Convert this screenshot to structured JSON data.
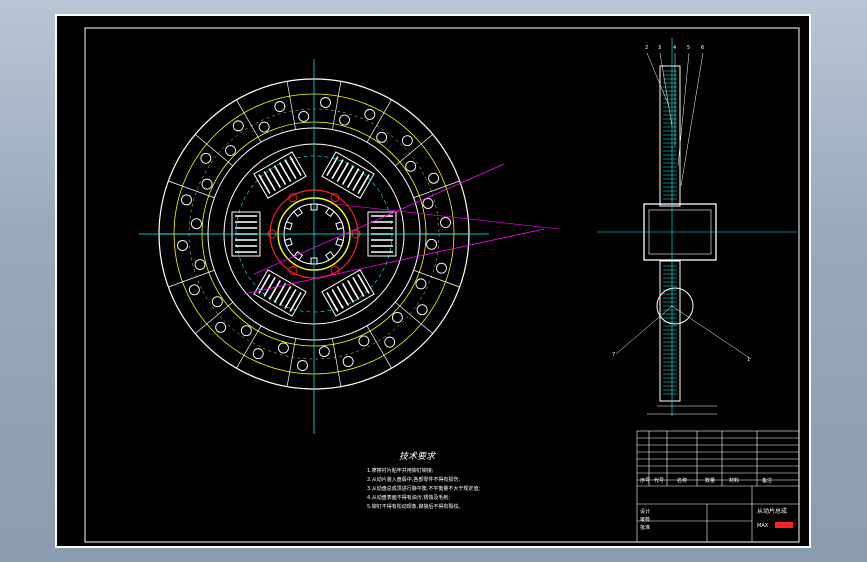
{
  "drawing": {
    "tech_title": "技术要求",
    "tech_notes": [
      "1.摩擦衬片粘牢并用铆钉铆接;",
      "2.从动片装入盘毂中,各部零件不得有损伤;",
      "3.从动盘总成须进行静平衡,不平衡量不大于规定值;",
      "4.从动盘表面不得有油污,锈蚀及毛刺;",
      "5.铆钉不得有松动现象,铆接后不得有裂纹。"
    ],
    "section_callouts": [
      "2",
      "3",
      "4",
      "5",
      "6",
      "7",
      "1"
    ],
    "title_block": {
      "drawing_name": "从动片总成",
      "header_labels": [
        "序号",
        "代号",
        "名称",
        "数量",
        "材料",
        "备注"
      ],
      "signature_labels": [
        "设计",
        "审核",
        "批准"
      ],
      "company": "",
      "brand_mark": "MAX",
      "brand_accent": "#ff2222"
    }
  },
  "colors": {
    "background_sheet": "#000000",
    "yellow": "#ffff00",
    "cyan": "#00ffff",
    "white": "#ffffff",
    "magenta": "#ff00ff",
    "red": "#ff2020"
  }
}
